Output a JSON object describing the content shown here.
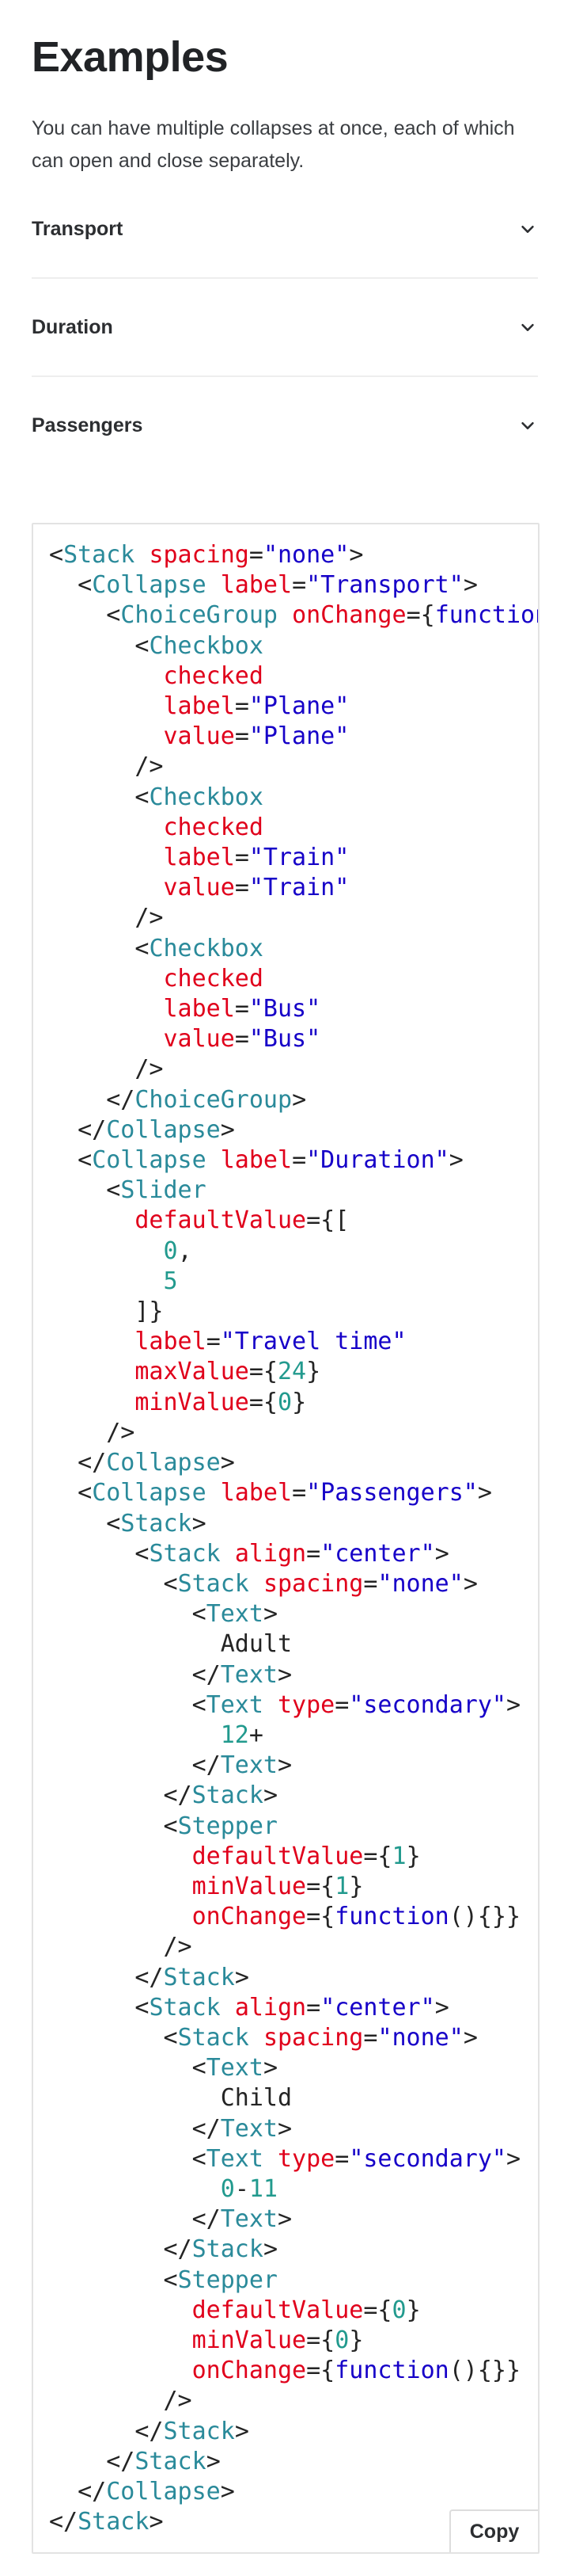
{
  "heading": "Examples",
  "intro": "You can have multiple collapses at once, each of which can open and close separately.",
  "collapses": [
    {
      "label": "Transport"
    },
    {
      "label": "Duration"
    },
    {
      "label": "Passengers"
    }
  ],
  "icons": {
    "chevron": "chevron-down-icon"
  },
  "code": {
    "copy_label": "Copy",
    "lines": [
      "<Stack spacing=\"none\">",
      "  <Collapse label=\"Transport\">",
      "    <ChoiceGroup onChange={function(){}}>",
      "      <Checkbox",
      "        checked",
      "        label=\"Plane\"",
      "        value=\"Plane\"",
      "      />",
      "      <Checkbox",
      "        checked",
      "        label=\"Train\"",
      "        value=\"Train\"",
      "      />",
      "      <Checkbox",
      "        checked",
      "        label=\"Bus\"",
      "        value=\"Bus\"",
      "      />",
      "    </ChoiceGroup>",
      "  </Collapse>",
      "  <Collapse label=\"Duration\">",
      "    <Slider",
      "      defaultValue={[",
      "        0,",
      "        5",
      "      ]}",
      "      label=\"Travel time\"",
      "      maxValue={24}",
      "      minValue={0}",
      "    />",
      "  </Collapse>",
      "  <Collapse label=\"Passengers\">",
      "    <Stack>",
      "      <Stack align=\"center\">",
      "        <Stack spacing=\"none\">",
      "          <Text>",
      "            Adult",
      "          </Text>",
      "          <Text type=\"secondary\">",
      "            12+",
      "          </Text>",
      "        </Stack>",
      "        <Stepper",
      "          defaultValue={1}",
      "          minValue={1}",
      "          onChange={function(){}}",
      "        />",
      "      </Stack>",
      "      <Stack align=\"center\">",
      "        <Stack spacing=\"none\">",
      "          <Text>",
      "            Child",
      "          </Text>",
      "          <Text type=\"secondary\">",
      "            0-11",
      "          </Text>",
      "        </Stack>",
      "        <Stepper",
      "          defaultValue={0}",
      "          minValue={0}",
      "          onChange={function(){}}",
      "        />",
      "      </Stack>",
      "    </Stack>",
      "  </Collapse>",
      "</Stack>"
    ]
  }
}
